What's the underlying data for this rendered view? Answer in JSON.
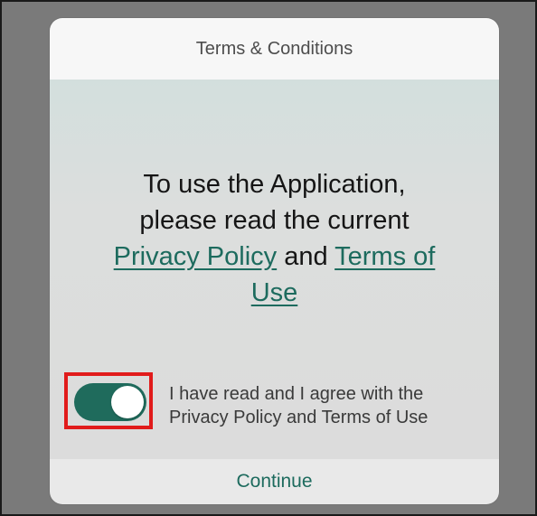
{
  "dialog": {
    "title": "Terms & Conditions",
    "message": {
      "line1": "To use the Application,",
      "line2": "please read the current",
      "privacy_link": "Privacy Policy",
      "and": " and ",
      "terms_link_part1": "Terms of",
      "terms_link_part2": "Use"
    },
    "consent": {
      "toggle_on": true,
      "line1": "I have read and I agree with the",
      "line2": "Privacy Policy and Terms of Use"
    },
    "continue_label": "Continue"
  },
  "colors": {
    "accent": "#1d6b5e",
    "toggle_on": "#1f6b5c",
    "highlight": "#e11b1b"
  }
}
